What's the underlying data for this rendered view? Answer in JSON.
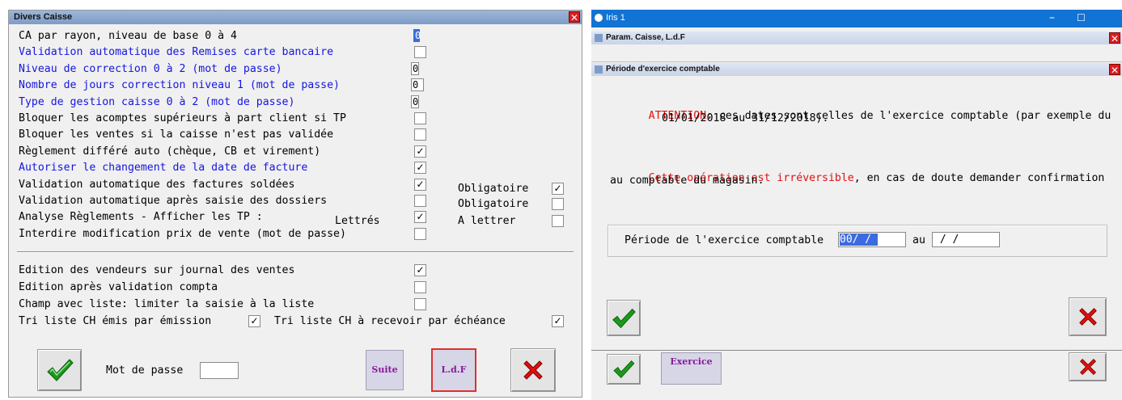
{
  "left_dialog": {
    "title": "Divers Caisse",
    "close_glyph": "✕",
    "rows": [
      {
        "label": "CA par rayon, niveau de base 0 à 4",
        "blue": false,
        "control": "num",
        "value": "0",
        "selected": true
      },
      {
        "label": "Validation automatique des Remises carte bancaire",
        "blue": true,
        "control": "check",
        "value": ""
      },
      {
        "label": "Niveau de correction 0 à 2 (mot de passe)",
        "blue": true,
        "control": "num",
        "value": "0"
      },
      {
        "label": "Nombre de jours correction niveau 1 (mot de passe)",
        "blue": true,
        "control": "num",
        "value": "0"
      },
      {
        "label": "Type de gestion caisse 0 à 2 (mot de passe)",
        "blue": true,
        "control": "num",
        "value": "0"
      },
      {
        "label": "Bloquer les acomptes supérieurs à part client si TP",
        "blue": false,
        "control": "check",
        "value": ""
      },
      {
        "label": "Bloquer les ventes si la caisse n'est pas validée",
        "blue": false,
        "control": "check",
        "value": ""
      },
      {
        "label": "Règlement différé auto (chèque, CB et virement)",
        "blue": false,
        "control": "check",
        "value": "✓"
      },
      {
        "label": "Autoriser le changement de la date de facture",
        "blue": true,
        "control": "check",
        "value": "✓"
      },
      {
        "label": "Validation automatique des factures soldées",
        "blue": false,
        "control": "check",
        "value": "✓"
      },
      {
        "label": "Validation automatique après saisie des dossiers",
        "blue": false,
        "control": "check",
        "value": ""
      },
      {
        "label": "Analyse Règlements - Afficher les TP :",
        "blue": false,
        "control": "check",
        "value": "✓"
      },
      {
        "label": "Interdire modification prix de vente (mot de passe)",
        "blue": false,
        "control": "check",
        "value": ""
      }
    ],
    "obligatoire_label": "Obligatoire",
    "obligatoire_1": "✓",
    "obligatoire_2": "",
    "lettres_label": "Lettrés",
    "a_lettrer_label": "A lettrer",
    "a_lettrer_value": "",
    "rows2": [
      {
        "label": "Edition des vendeurs sur journal des ventes",
        "value": "✓"
      },
      {
        "label": "Edition après validation compta",
        "value": ""
      },
      {
        "label": "Champ avec liste: limiter la saisie à la liste",
        "value": ""
      }
    ],
    "tri_emis_label": "Tri liste CH émis par émission",
    "tri_emis_value": "✓",
    "tri_recevoir_label": "Tri liste CH à recevoir par échéance",
    "tri_recevoir_value": "✓",
    "mot_de_passe_label": "Mot de passe",
    "mot_de_passe_value": "",
    "suite_label": "Suite",
    "ldf_label": "L.d.F"
  },
  "right_window": {
    "app_title": "Iris 1",
    "minimize_glyph": "–",
    "maximize_glyph": "☐",
    "param_title": "Param. Caisse, L.d.F",
    "periode_title": "Période d'exercice comptable",
    "close_glyph": "✕",
    "attention_label": "ATTENTION:",
    "attention_text": " ces dates sont celles de l'exercice comptable (par exemple du",
    "attention_text2": "01/01/2018 au 31/12/2018).",
    "irreversible_label": "Cette opération est irréversible",
    "irreversible_text": ", en cas de doute demander confirmation",
    "irreversible_text2": "au comptable du magasin.",
    "periode_label": "Période de l'exercice comptable",
    "date_from": "00/ / ",
    "au_label": "au",
    "date_to": " / / ",
    "exercice_label": "Exercice"
  },
  "colors": {
    "blue_text": "#1515e0",
    "red_text": "#e01010",
    "titlebar_blue": "#1173d3",
    "check_green": "#1a9a1a",
    "cancel_red": "#e01010"
  }
}
